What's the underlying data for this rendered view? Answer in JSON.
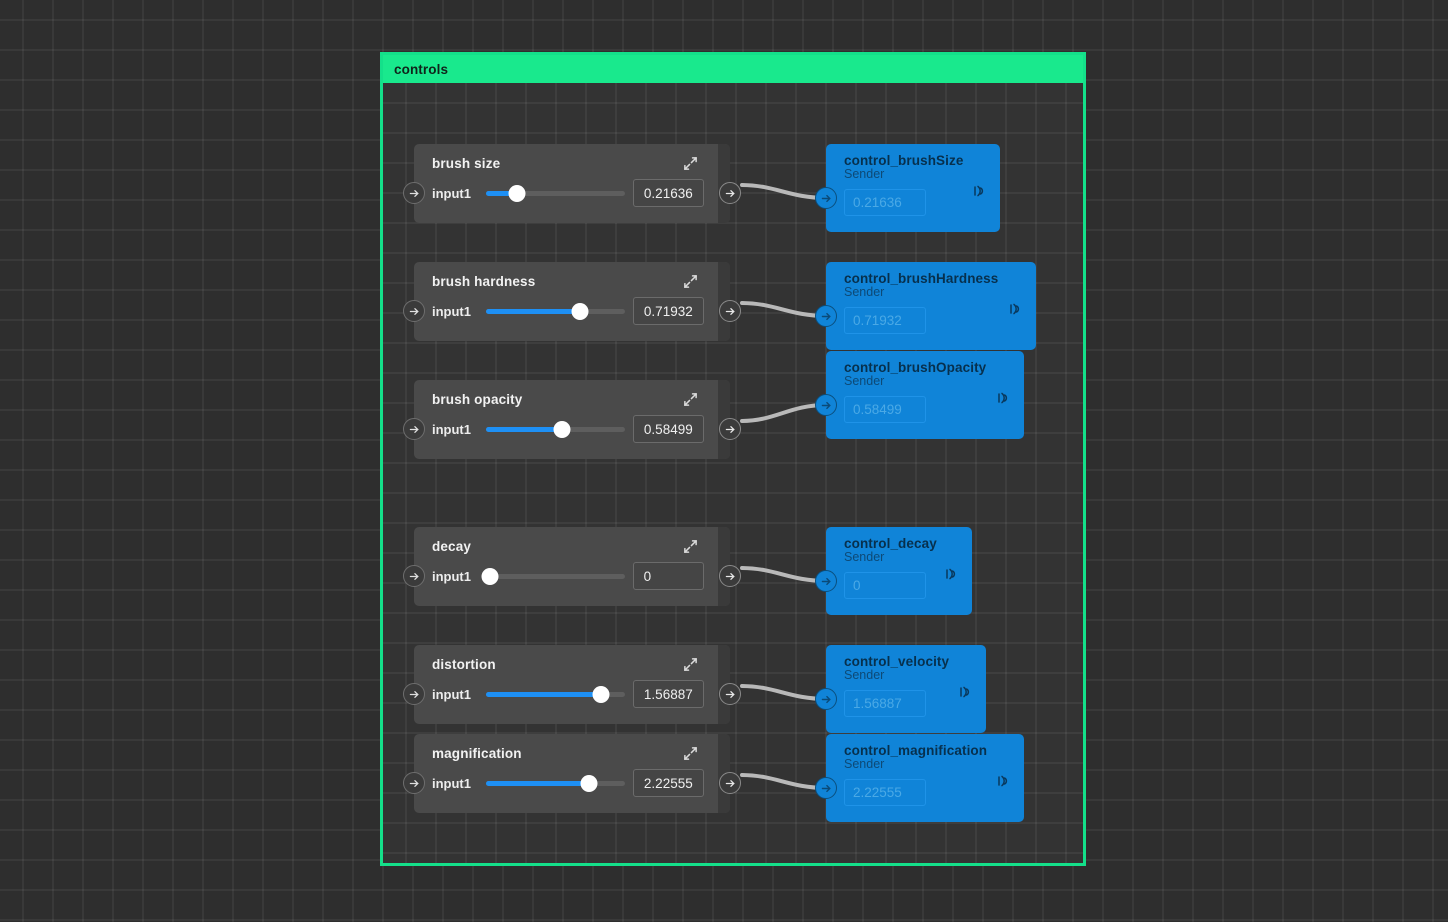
{
  "canvas": {
    "background_color": "#2e2e2e",
    "grid_color": "#3a3a3a"
  },
  "group": {
    "title": "controls",
    "accent_color": "#19e98d",
    "body_color": "#333333"
  },
  "icons": {
    "expand": "expand-diagonal-icon",
    "port_arrow": "arrow-right-icon",
    "broadcast": "broadcast-icon"
  },
  "sliders": [
    {
      "title": "brush size",
      "port_label": "input1",
      "value": "0.21636",
      "fill_percent": 22,
      "thumb_percent": 22
    },
    {
      "title": "brush hardness",
      "port_label": "input1",
      "value": "0.71932",
      "fill_percent": 68,
      "thumb_percent": 68
    },
    {
      "title": "brush opacity",
      "port_label": "input1",
      "value": "0.58499",
      "fill_percent": 55,
      "thumb_percent": 55
    },
    {
      "title": "decay",
      "port_label": "input1",
      "value": "0",
      "fill_percent": 0,
      "thumb_percent": 3
    },
    {
      "title": "distortion",
      "port_label": "input1",
      "value": "1.56887",
      "fill_percent": 83,
      "thumb_percent": 83
    },
    {
      "title": "magnification",
      "port_label": "input1",
      "value": "2.22555",
      "fill_percent": 74,
      "thumb_percent": 74
    }
  ],
  "senders": [
    {
      "title": "control_brushSize",
      "subtitle": "Sender",
      "value": "0.21636"
    },
    {
      "title": "control_brushHardness",
      "subtitle": "Sender",
      "value": "0.71932"
    },
    {
      "title": "control_brushOpacity",
      "subtitle": "Sender",
      "value": "0.58499"
    },
    {
      "title": "control_decay",
      "subtitle": "Sender",
      "value": "0"
    },
    {
      "title": "control_velocity",
      "subtitle": "Sender",
      "value": "1.56887"
    },
    {
      "title": "control_magnification",
      "subtitle": "Sender",
      "value": "2.22555"
    }
  ]
}
